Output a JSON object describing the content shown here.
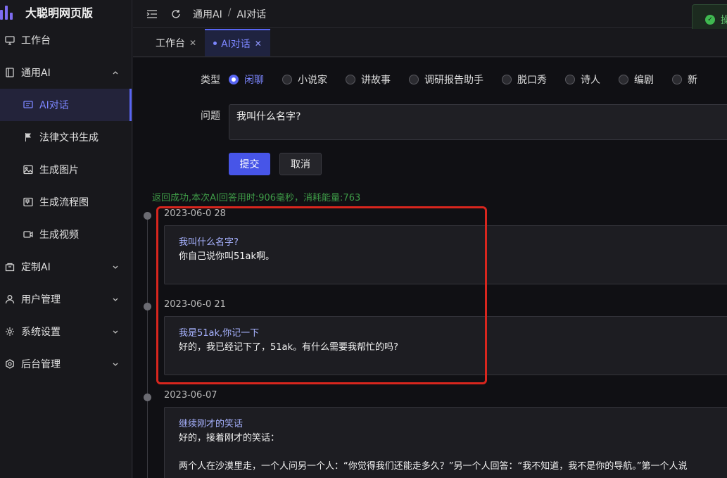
{
  "app": {
    "title": "大聪明网页版",
    "brand_color": "#7e6cf0",
    "accent": "#5865f2"
  },
  "sidebar": {
    "items": [
      {
        "label": "工作台",
        "icon": "monitor-icon"
      },
      {
        "label": "通用AI",
        "icon": "book-icon",
        "expanded": true,
        "children": [
          {
            "label": "AI对话",
            "icon": "chat-icon",
            "active": true
          },
          {
            "label": "法律文书生成",
            "icon": "flag-icon"
          },
          {
            "label": "生成图片",
            "icon": "image-icon"
          },
          {
            "label": "生成流程图",
            "icon": "flowchart-icon"
          },
          {
            "label": "生成视频",
            "icon": "video-icon"
          }
        ]
      },
      {
        "label": "定制AI",
        "icon": "shop-icon"
      },
      {
        "label": "用户管理",
        "icon": "user-icon"
      },
      {
        "label": "系统设置",
        "icon": "gear-icon"
      },
      {
        "label": "后台管理",
        "icon": "settings-icon"
      }
    ]
  },
  "header": {
    "breadcrumb": [
      "通用AI",
      "AI对话"
    ],
    "toast_text": "操"
  },
  "tabs": [
    {
      "label": "工作台",
      "active": false
    },
    {
      "label": "AI对话",
      "active": true
    }
  ],
  "form": {
    "type_label": "类型",
    "types": [
      "闲聊",
      "小说家",
      "讲故事",
      "调研报告助手",
      "脱口秀",
      "诗人",
      "编剧",
      "新"
    ],
    "selected_type": "闲聊",
    "question_label": "问题",
    "question_value": "我叫什么名字?",
    "submit_label": "提交",
    "cancel_label": "取消"
  },
  "status_message": "返回成功,本次AI回答用时:906毫秒，消耗能量:763",
  "timeline": [
    {
      "date": "2023-06-0      28",
      "question": "我叫什么名字?",
      "answer": "你自己说你叫51ak啊。"
    },
    {
      "date": "2023-06-0      21",
      "question": "我是51ak,你记一下",
      "answer": "好的，我已经记下了，51ak。有什么需要我帮忙的吗?"
    },
    {
      "date": "2023-06-07",
      "question": "继续刚才的笑话",
      "answer": "好的，接着刚才的笑话：\n\n两个人在沙漠里走，一个人问另一个人：“你觉得我们还能走多久？”另一个人回答：“我不知道，我不是你的导航。”第一个人说"
    }
  ]
}
